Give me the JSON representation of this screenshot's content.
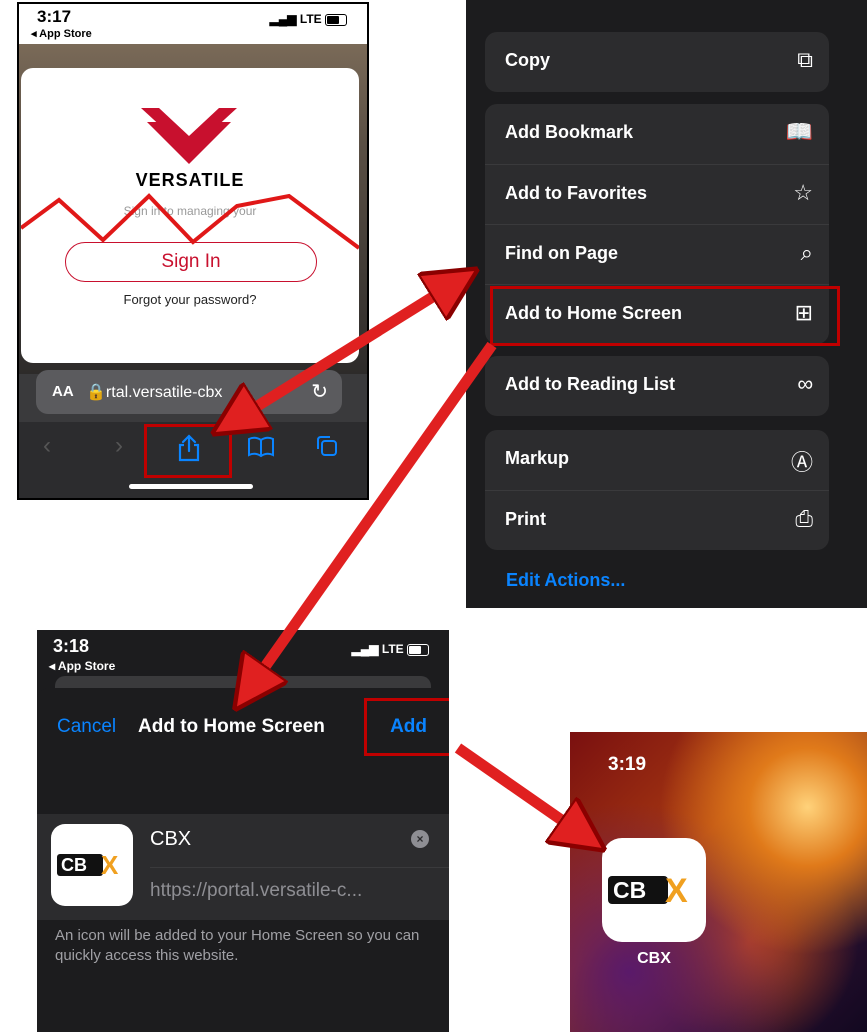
{
  "screen1": {
    "time": "3:17",
    "back": "◂ App Store",
    "network": "LTE",
    "brand": "VERSATILE",
    "subtitle": "Sign in to managing your",
    "signin_label": "Sign In",
    "forgot_label": "Forgot your password?",
    "aa_label": "AA",
    "url": "rtal.versatile-cbx"
  },
  "menu": {
    "items": [
      {
        "label": "Copy",
        "icon": "copy-icon"
      },
      {
        "label": "Add Bookmark",
        "icon": "book-icon"
      },
      {
        "label": "Add to Favorites",
        "icon": "star-icon"
      },
      {
        "label": "Find on Page",
        "icon": "search-icon"
      },
      {
        "label": "Add to Home Screen",
        "icon": "plus-square-icon"
      },
      {
        "label": "Add to Reading List",
        "icon": "glasses-icon"
      },
      {
        "label": "Markup",
        "icon": "markup-icon"
      },
      {
        "label": "Print",
        "icon": "printer-icon"
      }
    ],
    "edit_actions": "Edit Actions..."
  },
  "screen3": {
    "time": "3:18",
    "back": "◂ App Store",
    "network": "LTE",
    "cancel": "Cancel",
    "title": "Add to Home Screen",
    "add": "Add",
    "name_value": "CBX",
    "url_value": "https://portal.versatile-c...",
    "hint": "An icon will be added to your Home Screen so you can quickly access this website."
  },
  "screen4": {
    "time": "3:19",
    "app_label": "CBX"
  },
  "colors": {
    "highlight": "#c00000",
    "arrow": "#e02020",
    "ios_blue": "#0a84ff",
    "brand_red": "#c8102e"
  }
}
